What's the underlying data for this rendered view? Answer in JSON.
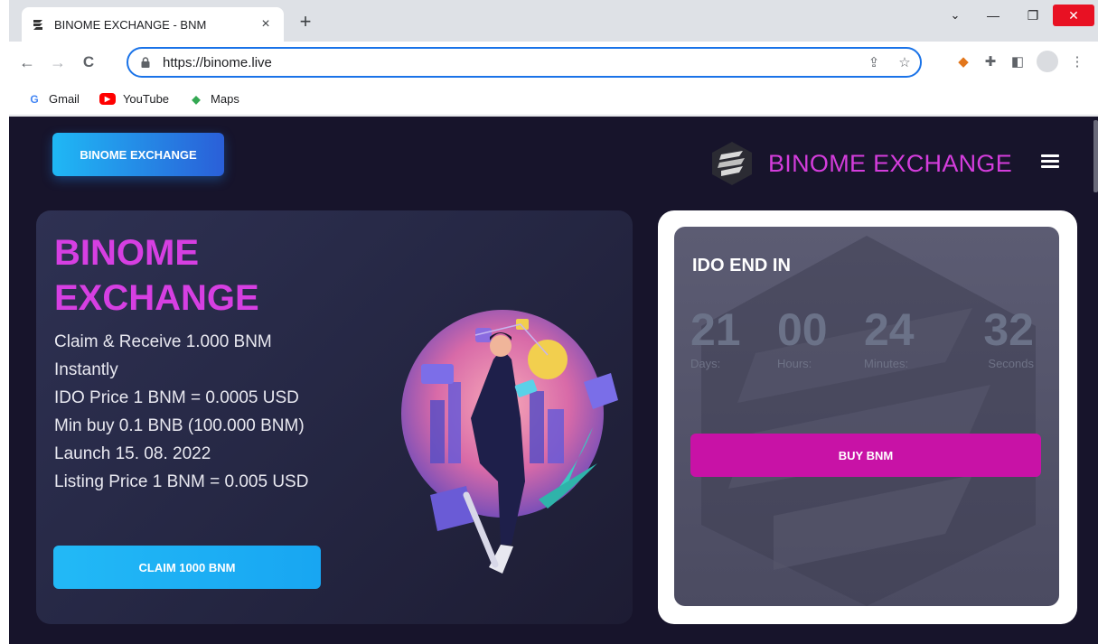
{
  "browser": {
    "tab_title": "BINOME EXCHANGE - BNM",
    "tab_close": "×",
    "new_tab": "+",
    "url": "https://binome.live",
    "back": "←",
    "forward": "→",
    "reload": "C",
    "bookmarks": [
      {
        "label": "Gmail",
        "icon": "gmail-icon"
      },
      {
        "label": "YouTube",
        "icon": "youtube-icon"
      },
      {
        "label": "Maps",
        "icon": "maps-icon"
      }
    ]
  },
  "header": {
    "top_button": "BINOME EXCHANGE",
    "brand_name": "BINOME EXCHANGE"
  },
  "hero": {
    "title_line1": "BINOME",
    "title_line2": "EXCHANGE",
    "lines": [
      "Claim & Receive 1.000 BNM",
      "Instantly",
      "IDO Price 1 BNM = 0.0005 USD",
      "Min buy 0.1 BNB (100.000 BNM)",
      "Launch 15. 08. 2022",
      "Listing Price 1 BNM = 0.005 USD"
    ],
    "claim_button": "CLAIM 1000 BNM"
  },
  "ido": {
    "title": "IDO END IN",
    "countdown": [
      {
        "value": "21",
        "label": "Days:"
      },
      {
        "value": "00",
        "label": "Hours:"
      },
      {
        "value": "24",
        "label": "Minutes:"
      },
      {
        "value": "32",
        "label": "Seconds"
      }
    ],
    "buy_button": "BUY BNM"
  },
  "colors": {
    "page_bg": "#17142b",
    "accent_magenta": "#d43ddc",
    "buy_button": "#c812a6",
    "blue_button": "#1fb8f5"
  }
}
